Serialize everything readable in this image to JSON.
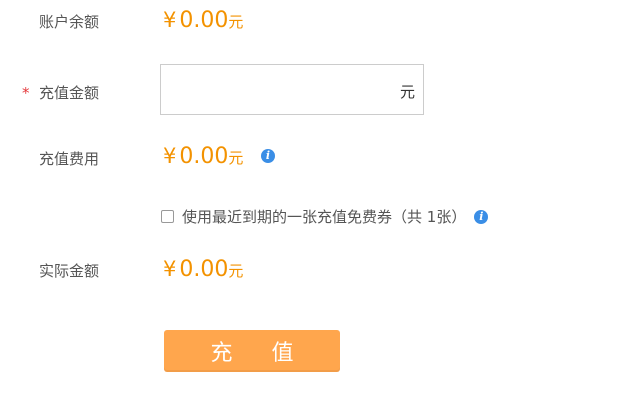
{
  "balance": {
    "label": "账户余额",
    "currency_symbol": "¥",
    "amount": "0.00",
    "unit": "元"
  },
  "recharge_amount": {
    "required_mark": "*",
    "label": "充值金额",
    "value": "",
    "placeholder": "",
    "unit": "元"
  },
  "fee": {
    "label": "充值费用",
    "currency_symbol": "¥",
    "amount": "0.00",
    "unit": "元",
    "info_icon": "info-icon"
  },
  "coupon": {
    "label": "使用最近到期的一张充值免费券（共 1张）",
    "checked": false,
    "info_icon": "info-icon"
  },
  "actual": {
    "label": "实际金额",
    "currency_symbol": "¥",
    "amount": "0.00",
    "unit": "元"
  },
  "submit": {
    "label": "充 值"
  },
  "colors": {
    "accent": "#f39200",
    "button": "#ffa64d",
    "required": "#e4393c",
    "info": "#3a8ee6"
  }
}
